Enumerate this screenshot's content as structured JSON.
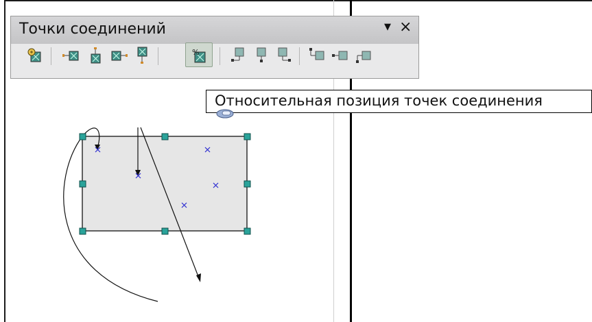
{
  "toolbar": {
    "title": "Точки соединений",
    "menu_icon": "dropdown-arrow-icon",
    "close_icon": "close-icon",
    "buttons": [
      {
        "name": "insert-glue-point",
        "icon": "insert-glue-point-icon"
      },
      {
        "name": "exit-direction-left",
        "icon": "exit-left-icon"
      },
      {
        "name": "exit-direction-top",
        "icon": "exit-top-icon"
      },
      {
        "name": "exit-direction-right",
        "icon": "exit-right-icon"
      },
      {
        "name": "exit-direction-bottom",
        "icon": "exit-bottom-icon"
      },
      {
        "name": "glue-point-relative",
        "icon": "glue-point-relative-icon",
        "active": true
      },
      {
        "name": "glue-point-horizontal-left",
        "icon": "horizontal-left-icon"
      },
      {
        "name": "glue-point-horizontal-center",
        "icon": "horizontal-center-icon"
      },
      {
        "name": "glue-point-horizontal-right",
        "icon": "horizontal-right-icon"
      },
      {
        "name": "glue-point-vertical-top",
        "icon": "vertical-top-icon"
      },
      {
        "name": "glue-point-vertical-center",
        "icon": "vertical-center-icon"
      },
      {
        "name": "glue-point-vertical-bottom",
        "icon": "vertical-bottom-icon"
      }
    ]
  },
  "tooltip": {
    "text": "Относительная позиция точек соединения"
  },
  "colors": {
    "handle": "#2aa39a",
    "shape_fill": "#e6e6e6",
    "glue_point": "#2a2ad0",
    "toolbar_bg": "#e9e9ea"
  }
}
